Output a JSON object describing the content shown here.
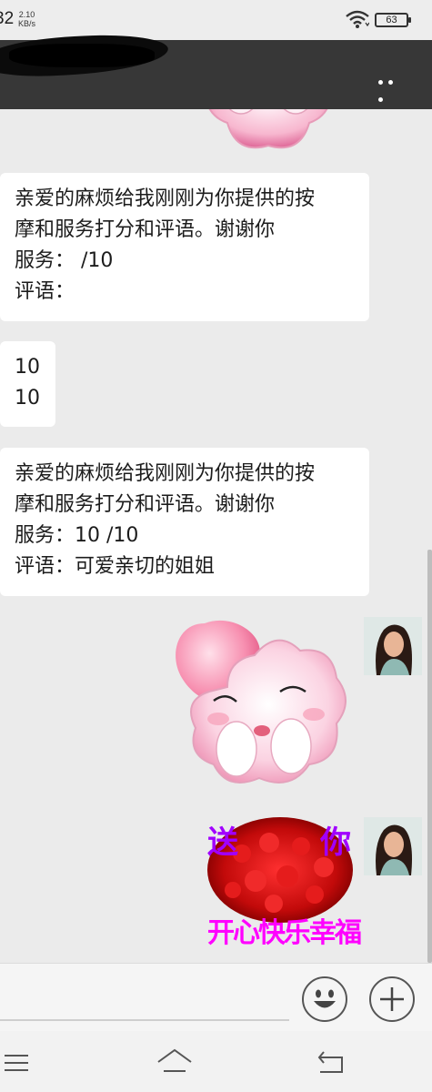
{
  "status_bar": {
    "time": "32",
    "net_speed_value": "2.10",
    "net_speed_unit": "KB/s",
    "battery": "63"
  },
  "chat": {
    "messages": [
      {
        "lines": [
          "亲爱的麻烦给我刚刚为你提供的按",
          "摩和服务打分和评语。谢谢你",
          "服务：  /10",
          "评语："
        ]
      },
      {
        "lines": [
          "10",
          "10"
        ]
      },
      {
        "lines": [
          "亲爱的麻烦给我刚刚为你提供的按",
          "摩和服务打分和评语。谢谢你",
          "服务：10 /10",
          "评语：可爱亲切的姐姐"
        ]
      }
    ],
    "sticker_text": {
      "left": "送",
      "right": "你",
      "bottom": "开心快乐幸福"
    }
  },
  "icons": {
    "more": "more-dots-icon",
    "emoji": "emoji-icon",
    "add": "plus-icon",
    "wifi": "wifi-icon",
    "nav_menu": "menu-icon",
    "nav_home": "home-icon",
    "nav_back": "back-icon"
  },
  "colors": {
    "title_bar": "#373737",
    "chat_bg": "#ebebeb",
    "bubble": "#ffffff",
    "sticker_text": "#a100ff",
    "sticker_text_bottom": "#ff00ff"
  }
}
